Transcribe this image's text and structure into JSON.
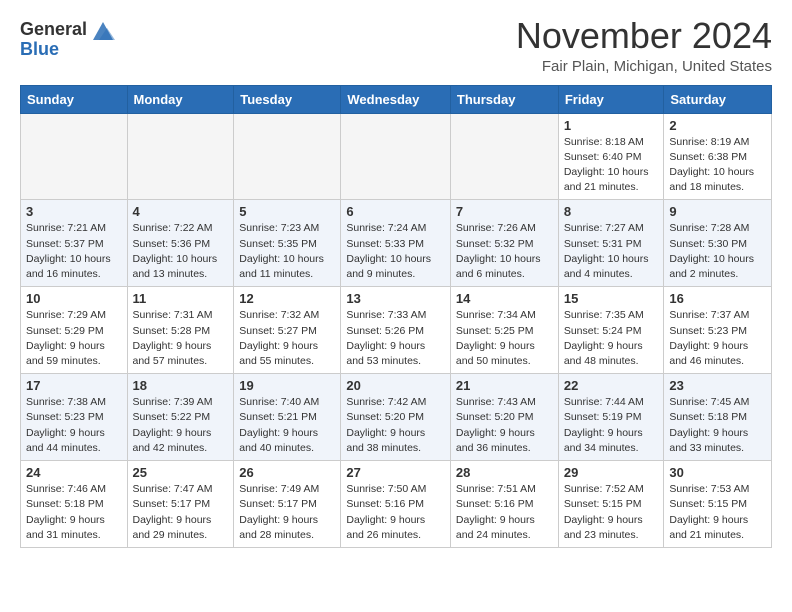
{
  "header": {
    "logo_general": "General",
    "logo_blue": "Blue",
    "month_title": "November 2024",
    "location": "Fair Plain, Michigan, United States"
  },
  "weekdays": [
    "Sunday",
    "Monday",
    "Tuesday",
    "Wednesday",
    "Thursday",
    "Friday",
    "Saturday"
  ],
  "weeks": [
    [
      {
        "day": "",
        "info": ""
      },
      {
        "day": "",
        "info": ""
      },
      {
        "day": "",
        "info": ""
      },
      {
        "day": "",
        "info": ""
      },
      {
        "day": "",
        "info": ""
      },
      {
        "day": "1",
        "info": "Sunrise: 8:18 AM\nSunset: 6:40 PM\nDaylight: 10 hours and 21 minutes."
      },
      {
        "day": "2",
        "info": "Sunrise: 8:19 AM\nSunset: 6:38 PM\nDaylight: 10 hours and 18 minutes."
      }
    ],
    [
      {
        "day": "3",
        "info": "Sunrise: 7:21 AM\nSunset: 5:37 PM\nDaylight: 10 hours and 16 minutes."
      },
      {
        "day": "4",
        "info": "Sunrise: 7:22 AM\nSunset: 5:36 PM\nDaylight: 10 hours and 13 minutes."
      },
      {
        "day": "5",
        "info": "Sunrise: 7:23 AM\nSunset: 5:35 PM\nDaylight: 10 hours and 11 minutes."
      },
      {
        "day": "6",
        "info": "Sunrise: 7:24 AM\nSunset: 5:33 PM\nDaylight: 10 hours and 9 minutes."
      },
      {
        "day": "7",
        "info": "Sunrise: 7:26 AM\nSunset: 5:32 PM\nDaylight: 10 hours and 6 minutes."
      },
      {
        "day": "8",
        "info": "Sunrise: 7:27 AM\nSunset: 5:31 PM\nDaylight: 10 hours and 4 minutes."
      },
      {
        "day": "9",
        "info": "Sunrise: 7:28 AM\nSunset: 5:30 PM\nDaylight: 10 hours and 2 minutes."
      }
    ],
    [
      {
        "day": "10",
        "info": "Sunrise: 7:29 AM\nSunset: 5:29 PM\nDaylight: 9 hours and 59 minutes."
      },
      {
        "day": "11",
        "info": "Sunrise: 7:31 AM\nSunset: 5:28 PM\nDaylight: 9 hours and 57 minutes."
      },
      {
        "day": "12",
        "info": "Sunrise: 7:32 AM\nSunset: 5:27 PM\nDaylight: 9 hours and 55 minutes."
      },
      {
        "day": "13",
        "info": "Sunrise: 7:33 AM\nSunset: 5:26 PM\nDaylight: 9 hours and 53 minutes."
      },
      {
        "day": "14",
        "info": "Sunrise: 7:34 AM\nSunset: 5:25 PM\nDaylight: 9 hours and 50 minutes."
      },
      {
        "day": "15",
        "info": "Sunrise: 7:35 AM\nSunset: 5:24 PM\nDaylight: 9 hours and 48 minutes."
      },
      {
        "day": "16",
        "info": "Sunrise: 7:37 AM\nSunset: 5:23 PM\nDaylight: 9 hours and 46 minutes."
      }
    ],
    [
      {
        "day": "17",
        "info": "Sunrise: 7:38 AM\nSunset: 5:23 PM\nDaylight: 9 hours and 44 minutes."
      },
      {
        "day": "18",
        "info": "Sunrise: 7:39 AM\nSunset: 5:22 PM\nDaylight: 9 hours and 42 minutes."
      },
      {
        "day": "19",
        "info": "Sunrise: 7:40 AM\nSunset: 5:21 PM\nDaylight: 9 hours and 40 minutes."
      },
      {
        "day": "20",
        "info": "Sunrise: 7:42 AM\nSunset: 5:20 PM\nDaylight: 9 hours and 38 minutes."
      },
      {
        "day": "21",
        "info": "Sunrise: 7:43 AM\nSunset: 5:20 PM\nDaylight: 9 hours and 36 minutes."
      },
      {
        "day": "22",
        "info": "Sunrise: 7:44 AM\nSunset: 5:19 PM\nDaylight: 9 hours and 34 minutes."
      },
      {
        "day": "23",
        "info": "Sunrise: 7:45 AM\nSunset: 5:18 PM\nDaylight: 9 hours and 33 minutes."
      }
    ],
    [
      {
        "day": "24",
        "info": "Sunrise: 7:46 AM\nSunset: 5:18 PM\nDaylight: 9 hours and 31 minutes."
      },
      {
        "day": "25",
        "info": "Sunrise: 7:47 AM\nSunset: 5:17 PM\nDaylight: 9 hours and 29 minutes."
      },
      {
        "day": "26",
        "info": "Sunrise: 7:49 AM\nSunset: 5:17 PM\nDaylight: 9 hours and 28 minutes."
      },
      {
        "day": "27",
        "info": "Sunrise: 7:50 AM\nSunset: 5:16 PM\nDaylight: 9 hours and 26 minutes."
      },
      {
        "day": "28",
        "info": "Sunrise: 7:51 AM\nSunset: 5:16 PM\nDaylight: 9 hours and 24 minutes."
      },
      {
        "day": "29",
        "info": "Sunrise: 7:52 AM\nSunset: 5:15 PM\nDaylight: 9 hours and 23 minutes."
      },
      {
        "day": "30",
        "info": "Sunrise: 7:53 AM\nSunset: 5:15 PM\nDaylight: 9 hours and 21 minutes."
      }
    ]
  ]
}
